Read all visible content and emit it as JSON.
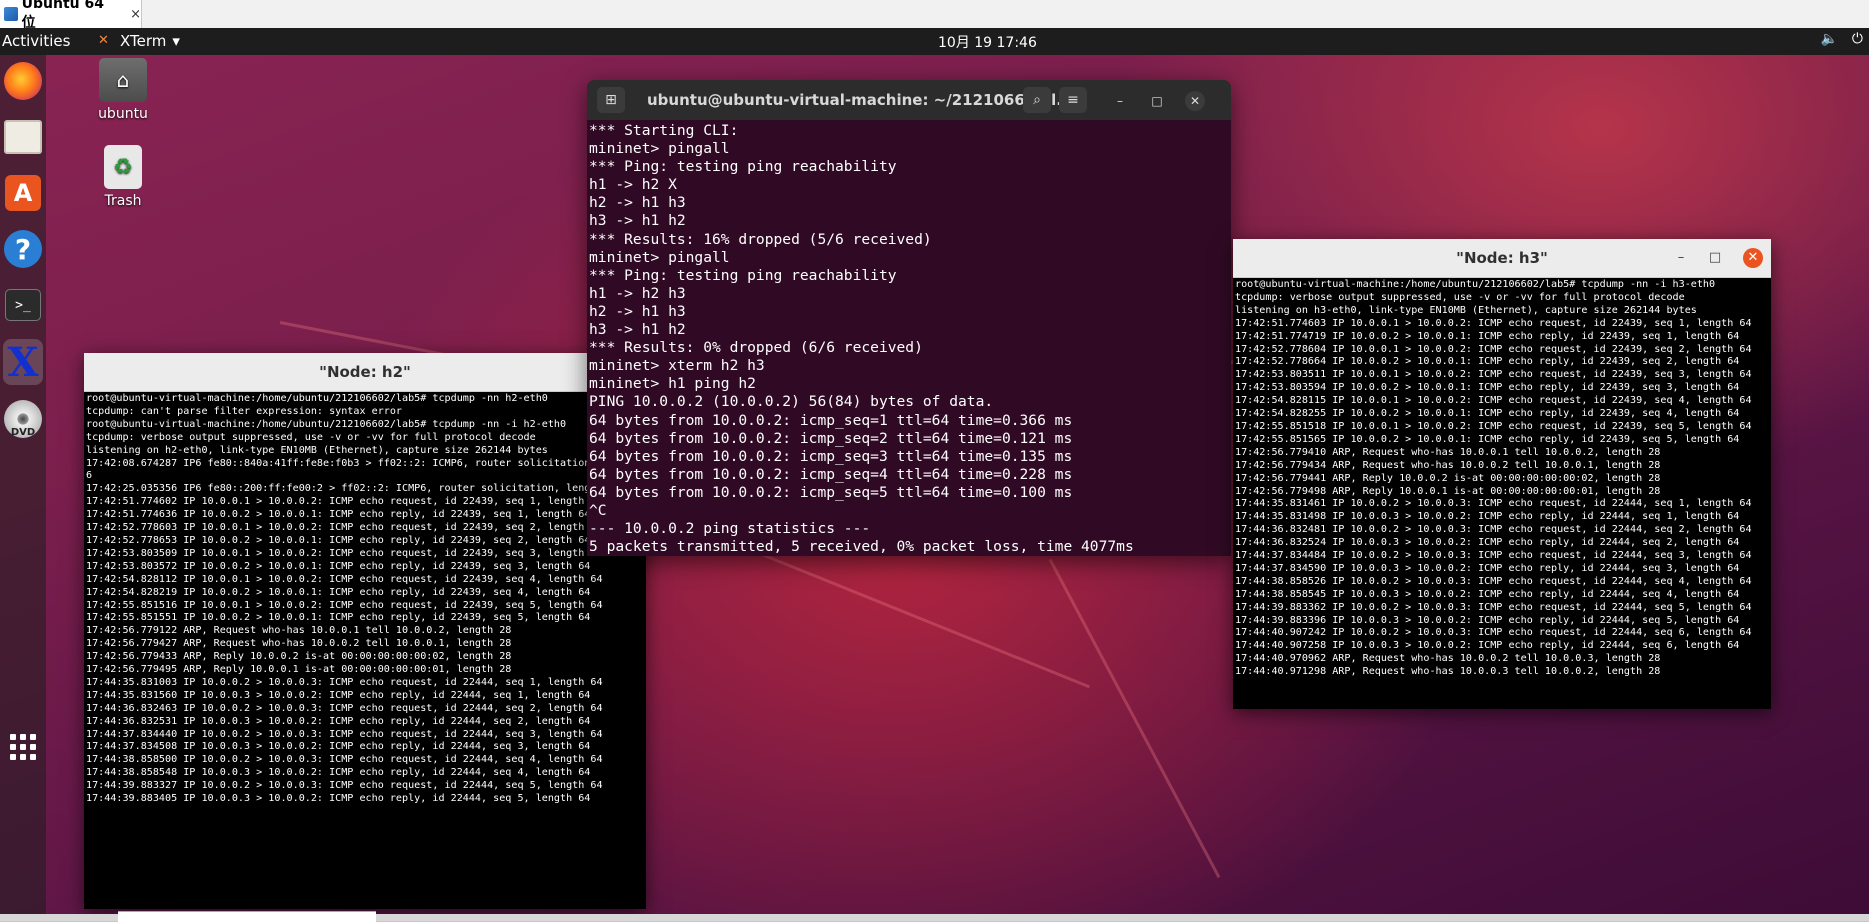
{
  "vm": {
    "tab_title": "Ubuntu 64 位",
    "tab_close": "×"
  },
  "topbar": {
    "activities": "Activities",
    "app_name": "XTerm",
    "app_arrow": "▾",
    "clock": "10月 19  17:46",
    "tray_volume": "🔈",
    "tray_power": "⏻"
  },
  "desktop_icons": [
    {
      "label": "ubuntu",
      "icon": "home-folder-icon"
    },
    {
      "label": "Trash",
      "icon": "trash-icon"
    }
  ],
  "dock": [
    "firefox-icon",
    "files-icon",
    "software-icon",
    "help-icon",
    "terminal-icon",
    "xterm-icon",
    "dvd-icon",
    "show-apps-icon"
  ],
  "gterm": {
    "title": "ubuntu@ubuntu-virtual-machine: ~/212106602/l...",
    "lines": [
      "*** Starting CLI:",
      "mininet> pingall",
      "*** Ping: testing ping reachability",
      "h1 -> h2 X",
      "h2 -> h1 h3",
      "h3 -> h1 h2",
      "*** Results: 16% dropped (5/6 received)",
      "mininet> pingall",
      "*** Ping: testing ping reachability",
      "h1 -> h2 h3",
      "h2 -> h1 h3",
      "h3 -> h1 h2",
      "*** Results: 0% dropped (6/6 received)",
      "mininet> xterm h2 h3",
      "mininet> h1 ping h2",
      "PING 10.0.0.2 (10.0.0.2) 56(84) bytes of data.",
      "64 bytes from 10.0.0.2: icmp_seq=1 ttl=64 time=0.366 ms",
      "64 bytes from 10.0.0.2: icmp_seq=2 ttl=64 time=0.121 ms",
      "64 bytes from 10.0.0.2: icmp_seq=3 ttl=64 time=0.135 ms",
      "64 bytes from 10.0.0.2: icmp_seq=4 ttl=64 time=0.228 ms",
      "64 bytes from 10.0.0.2: icmp_seq=5 ttl=64 time=0.100 ms",
      "^C",
      "--- 10.0.0.2 ping statistics ---",
      "5 packets transmitted, 5 received, 0% packet loss, time 4077ms"
    ]
  },
  "h2": {
    "title": "\"Node: h2\"",
    "lines": [
      "root@ubuntu-virtual-machine:/home/ubuntu/212106602/lab5# tcpdump -nn h2-eth0",
      "tcpdump: can't parse filter expression: syntax error",
      "root@ubuntu-virtual-machine:/home/ubuntu/212106602/lab5# tcpdump -nn -i h2-eth0",
      "tcpdump: verbose output suppressed, use -v or -vv for full protocol decode",
      "listening on h2-eth0, link-type EN10MB (Ethernet), capture size 262144 bytes",
      "17:42:08.674287 IP6 fe80::840a:41ff:fe8e:f0b3 > ff02::2: ICMP6, router solicitation, length 1",
      "6",
      "17:42:25.035356 IP6 fe80::200:ff:fe00:2 > ff02::2: ICMP6, router solicitation, length 16",
      "17:42:51.774602 IP 10.0.0.1 > 10.0.0.2: ICMP echo request, id 22439, seq 1, length 64",
      "17:42:51.774636 IP 10.0.0.2 > 10.0.0.1: ICMP echo reply, id 22439, seq 1, length 64",
      "17:42:52.778603 IP 10.0.0.1 > 10.0.0.2: ICMP echo request, id 22439, seq 2, length 64",
      "17:42:52.778653 IP 10.0.0.2 > 10.0.0.1: ICMP echo reply, id 22439, seq 2, length 64",
      "17:42:53.803509 IP 10.0.0.1 > 10.0.0.2: ICMP echo request, id 22439, seq 3, length 64",
      "17:42:53.803572 IP 10.0.0.2 > 10.0.0.1: ICMP echo reply, id 22439, seq 3, length 64",
      "17:42:54.828112 IP 10.0.0.1 > 10.0.0.2: ICMP echo request, id 22439, seq 4, length 64",
      "17:42:54.828219 IP 10.0.0.2 > 10.0.0.1: ICMP echo reply, id 22439, seq 4, length 64",
      "17:42:55.851516 IP 10.0.0.1 > 10.0.0.2: ICMP echo request, id 22439, seq 5, length 64",
      "17:42:55.851551 IP 10.0.0.2 > 10.0.0.1: ICMP echo reply, id 22439, seq 5, length 64",
      "17:42:56.779122 ARP, Request who-has 10.0.0.1 tell 10.0.0.2, length 28",
      "17:42:56.779427 ARP, Request who-has 10.0.0.2 tell 10.0.0.1, length 28",
      "17:42:56.779433 ARP, Reply 10.0.0.2 is-at 00:00:00:00:00:02, length 28",
      "17:42:56.779495 ARP, Reply 10.0.0.1 is-at 00:00:00:00:00:01, length 28",
      "17:44:35.831003 IP 10.0.0.2 > 10.0.0.3: ICMP echo request, id 22444, seq 1, length 64",
      "17:44:35.831560 IP 10.0.0.3 > 10.0.0.2: ICMP echo reply, id 22444, seq 1, length 64",
      "17:44:36.832463 IP 10.0.0.2 > 10.0.0.3: ICMP echo request, id 22444, seq 2, length 64",
      "17:44:36.832531 IP 10.0.0.3 > 10.0.0.2: ICMP echo reply, id 22444, seq 2, length 64",
      "17:44:37.834440 IP 10.0.0.2 > 10.0.0.3: ICMP echo request, id 22444, seq 3, length 64",
      "17:44:37.834508 IP 10.0.0.3 > 10.0.0.2: ICMP echo reply, id 22444, seq 3, length 64",
      "17:44:38.858500 IP 10.0.0.2 > 10.0.0.3: ICMP echo request, id 22444, seq 4, length 64",
      "17:44:38.858548 IP 10.0.0.3 > 10.0.0.2: ICMP echo reply, id 22444, seq 4, length 64",
      "17:44:39.883327 IP 10.0.0.2 > 10.0.0.3: ICMP echo request, id 22444, seq 5, length 64",
      "17:44:39.883405 IP 10.0.0.3 > 10.0.0.2: ICMP echo reply, id 22444, seq 5, length 64"
    ]
  },
  "h3": {
    "title": "\"Node: h3\"",
    "lines": [
      "root@ubuntu-virtual-machine:/home/ubuntu/212106602/lab5# tcpdump -nn -i h3-eth0",
      "tcpdump: verbose output suppressed, use -v or -vv for full protocol decode",
      "listening on h3-eth0, link-type EN10MB (Ethernet), capture size 262144 bytes",
      "17:42:51.774603 IP 10.0.0.1 > 10.0.0.2: ICMP echo request, id 22439, seq 1, length 64",
      "17:42:51.774719 IP 10.0.0.2 > 10.0.0.1: ICMP echo reply, id 22439, seq 1, length 64",
      "17:42:52.778604 IP 10.0.0.1 > 10.0.0.2: ICMP echo request, id 22439, seq 2, length 64",
      "17:42:52.778664 IP 10.0.0.2 > 10.0.0.1: ICMP echo reply, id 22439, seq 2, length 64",
      "17:42:53.803511 IP 10.0.0.1 > 10.0.0.2: ICMP echo request, id 22439, seq 3, length 64",
      "17:42:53.803594 IP 10.0.0.2 > 10.0.0.1: ICMP echo reply, id 22439, seq 3, length 64",
      "17:42:54.828115 IP 10.0.0.1 > 10.0.0.2: ICMP echo request, id 22439, seq 4, length 64",
      "17:42:54.828255 IP 10.0.0.2 > 10.0.0.1: ICMP echo reply, id 22439, seq 4, length 64",
      "17:42:55.851518 IP 10.0.0.1 > 10.0.0.2: ICMP echo request, id 22439, seq 5, length 64",
      "17:42:55.851565 IP 10.0.0.2 > 10.0.0.1: ICMP echo reply, id 22439, seq 5, length 64",
      "17:42:56.779410 ARP, Request who-has 10.0.0.1 tell 10.0.0.2, length 28",
      "17:42:56.779434 ARP, Request who-has 10.0.0.2 tell 10.0.0.1, length 28",
      "17:42:56.779441 ARP, Reply 10.0.0.2 is-at 00:00:00:00:00:02, length 28",
      "17:42:56.779498 ARP, Reply 10.0.0.1 is-at 00:00:00:00:00:01, length 28",
      "17:44:35.831461 IP 10.0.0.2 > 10.0.0.3: ICMP echo request, id 22444, seq 1, length 64",
      "17:44:35.831498 IP 10.0.0.3 > 10.0.0.2: ICMP echo reply, id 22444, seq 1, length 64",
      "17:44:36.832481 IP 10.0.0.2 > 10.0.0.3: ICMP echo request, id 22444, seq 2, length 64",
      "17:44:36.832524 IP 10.0.0.3 > 10.0.0.2: ICMP echo reply, id 22444, seq 2, length 64",
      "17:44:37.834484 IP 10.0.0.2 > 10.0.0.3: ICMP echo request, id 22444, seq 3, length 64",
      "17:44:37.834590 IP 10.0.0.3 > 10.0.0.2: ICMP echo reply, id 22444, seq 3, length 64",
      "17:44:38.858526 IP 10.0.0.2 > 10.0.0.3: ICMP echo request, id 22444, seq 4, length 64",
      "17:44:38.858545 IP 10.0.0.3 > 10.0.0.2: ICMP echo reply, id 22444, seq 4, length 64",
      "17:44:39.883362 IP 10.0.0.2 > 10.0.0.3: ICMP echo request, id 22444, seq 5, length 64",
      "17:44:39.883396 IP 10.0.0.3 > 10.0.0.2: ICMP echo reply, id 22444, seq 5, length 64",
      "17:44:40.907242 IP 10.0.0.2 > 10.0.0.3: ICMP echo request, id 22444, seq 6, length 64",
      "17:44:40.907258 IP 10.0.0.3 > 10.0.0.2: ICMP echo reply, id 22444, seq 6, length 64",
      "17:44:40.970962 ARP, Request who-has 10.0.0.2 tell 10.0.0.3, length 28",
      "17:44:40.971298 ARP, Request who-has 10.0.0.3 tell 10.0.0.2, length 28"
    ]
  }
}
